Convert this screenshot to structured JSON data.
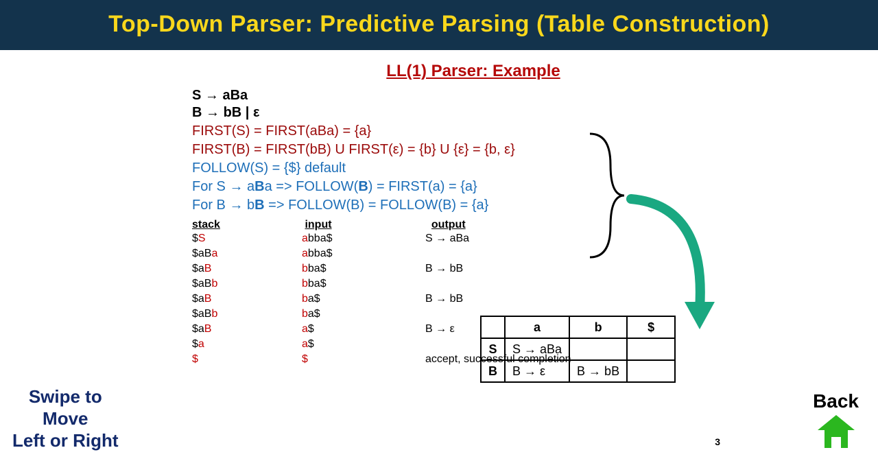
{
  "header": {
    "title": "Top-Down Parser: Predictive Parsing (Table Construction)"
  },
  "subtitle": "LL(1) Parser: Example",
  "grammar": {
    "rule1_lhs": "S",
    "rule1_rhs": "aBa",
    "rule2_lhs": "B",
    "rule2_rhs": "bB  | ε"
  },
  "first": {
    "l1": "FIRST(S) = FIRST(aBa) = {a}",
    "l2": "FIRST(B) = FIRST(bB) U FIRST(ε) = {b} U {ε} = {b, ε}"
  },
  "follow": {
    "l1": "FOLLOW(S) = {$}    default",
    "l2_pre": "For S → a",
    "l2_b": "B",
    "l2_post": "a  => FOLLOW(",
    "l2_b2": "B",
    "l2_end": ") = FIRST(a) = {a}",
    "l3_pre": "For B → b",
    "l3_b": "B",
    "l3_post": "   => FOLLOW(B) = FOLLOW(B) = {a}"
  },
  "trace_headers": {
    "stack": "stack",
    "input": "input",
    "output": "output"
  },
  "trace": [
    {
      "s_pre": "$",
      "s_r": "S",
      "s_suf": "",
      "i_r": "a",
      "i_suf": "bba$",
      "out": "S → aBa"
    },
    {
      "s_pre": "$aB",
      "s_r": "a",
      "s_suf": "",
      "i_r": "a",
      "i_suf": "bba$",
      "out": ""
    },
    {
      "s_pre": "$a",
      "s_r": "B",
      "s_suf": "",
      "i_r": "b",
      "i_suf": "ba$",
      "out": "B → bB"
    },
    {
      "s_pre": "$aB",
      "s_r": "b",
      "s_suf": "",
      "i_r": "b",
      "i_suf": "ba$",
      "out": ""
    },
    {
      "s_pre": "$a",
      "s_r": "B",
      "s_suf": "",
      "i_r": "b",
      "i_suf": "a$",
      "out": "B → bB"
    },
    {
      "s_pre": "$aB",
      "s_r": "b",
      "s_suf": "",
      "i_r": "b",
      "i_suf": "a$",
      "out": ""
    },
    {
      "s_pre": "$a",
      "s_r": "B",
      "s_suf": "",
      "i_r": "a",
      "i_suf": "$",
      "out": "B → ε"
    },
    {
      "s_pre": "$",
      "s_r": "a",
      "s_suf": "",
      "i_r": "a",
      "i_suf": "$",
      "out": ""
    },
    {
      "s_pre": "",
      "s_r": "$",
      "s_suf": "",
      "i_r": "$",
      "i_suf": "",
      "out": "accept, successful completion"
    }
  ],
  "parse_table": {
    "cols": [
      "a",
      "b",
      "$"
    ],
    "rows": [
      {
        "h": "S",
        "a": "S → aBa",
        "b": "",
        "d": ""
      },
      {
        "h": "B",
        "a": "B → ε",
        "b": "B → bB",
        "d": ""
      }
    ]
  },
  "nav": {
    "swipe_l1": "Swipe to",
    "swipe_l2": "Move",
    "swipe_l3": "Left or Right",
    "back": "Back"
  },
  "page_number": "3"
}
